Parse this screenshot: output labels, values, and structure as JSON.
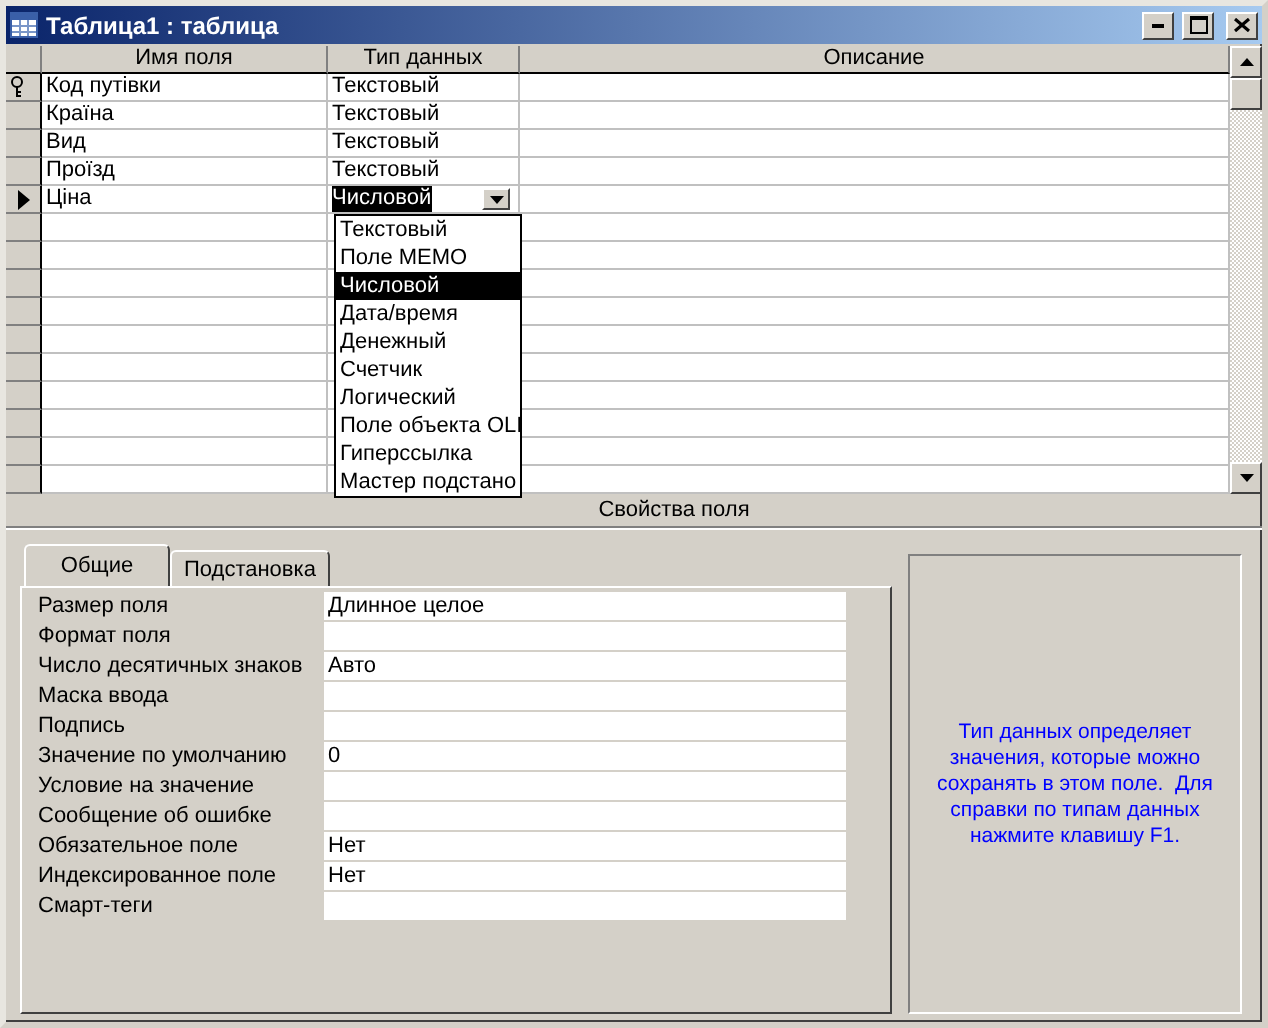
{
  "window": {
    "title": "Таблица1 : таблица"
  },
  "table": {
    "columns": [
      "Имя поля",
      "Тип данных",
      "Описание"
    ],
    "rows": [
      {
        "name": "Код путівки",
        "type": "Текстовый",
        "primary_key": true,
        "current": false
      },
      {
        "name": "Країна",
        "type": "Текстовый",
        "primary_key": false,
        "current": false
      },
      {
        "name": "Вид",
        "type": "Текстовый",
        "primary_key": false,
        "current": false
      },
      {
        "name": "Проїзд",
        "type": "Текстовый",
        "primary_key": false,
        "current": false
      },
      {
        "name": "Ціна",
        "type": "Числовой",
        "primary_key": false,
        "current": true
      }
    ]
  },
  "type_dropdown": {
    "options": [
      {
        "label": "Текстовый",
        "selected": false
      },
      {
        "label": "Поле MEMO",
        "selected": false
      },
      {
        "label": "Числовой",
        "selected": true
      },
      {
        "label": "Дата/время",
        "selected": false
      },
      {
        "label": "Денежный",
        "selected": false
      },
      {
        "label": "Счетчик",
        "selected": false
      },
      {
        "label": "Логический",
        "selected": false
      },
      {
        "label": "Поле объекта OLI",
        "selected": false
      },
      {
        "label": "Гиперссылка",
        "selected": false
      },
      {
        "label": "Мастер подстано",
        "selected": false
      }
    ]
  },
  "properties": {
    "title": "Свойства поля",
    "tabs": [
      {
        "label": "Общие",
        "selected": true
      },
      {
        "label": "Подстановка",
        "selected": false
      }
    ],
    "fields": [
      {
        "label": "Размер поля",
        "value": "Длинное целое"
      },
      {
        "label": "Формат поля"
      },
      {
        "label": "Число десятичных знаков",
        "value": "Авто"
      },
      {
        "label": "Маска ввода"
      },
      {
        "label": "Подпись"
      },
      {
        "label": "Значение по умолчанию",
        "value": "0"
      },
      {
        "label": "Условие на значение"
      },
      {
        "label": "Сообщение об ошибке"
      },
      {
        "label": "Обязательное поле",
        "value": "Нет"
      },
      {
        "label": "Индексированное поле",
        "value": "Нет"
      },
      {
        "label": "Смарт-теги"
      }
    ]
  },
  "help_text": "Тип данных определяет значения, которые можно сохранять в этом поле.  Для справки по типам данных нажмите клавишу F1."
}
